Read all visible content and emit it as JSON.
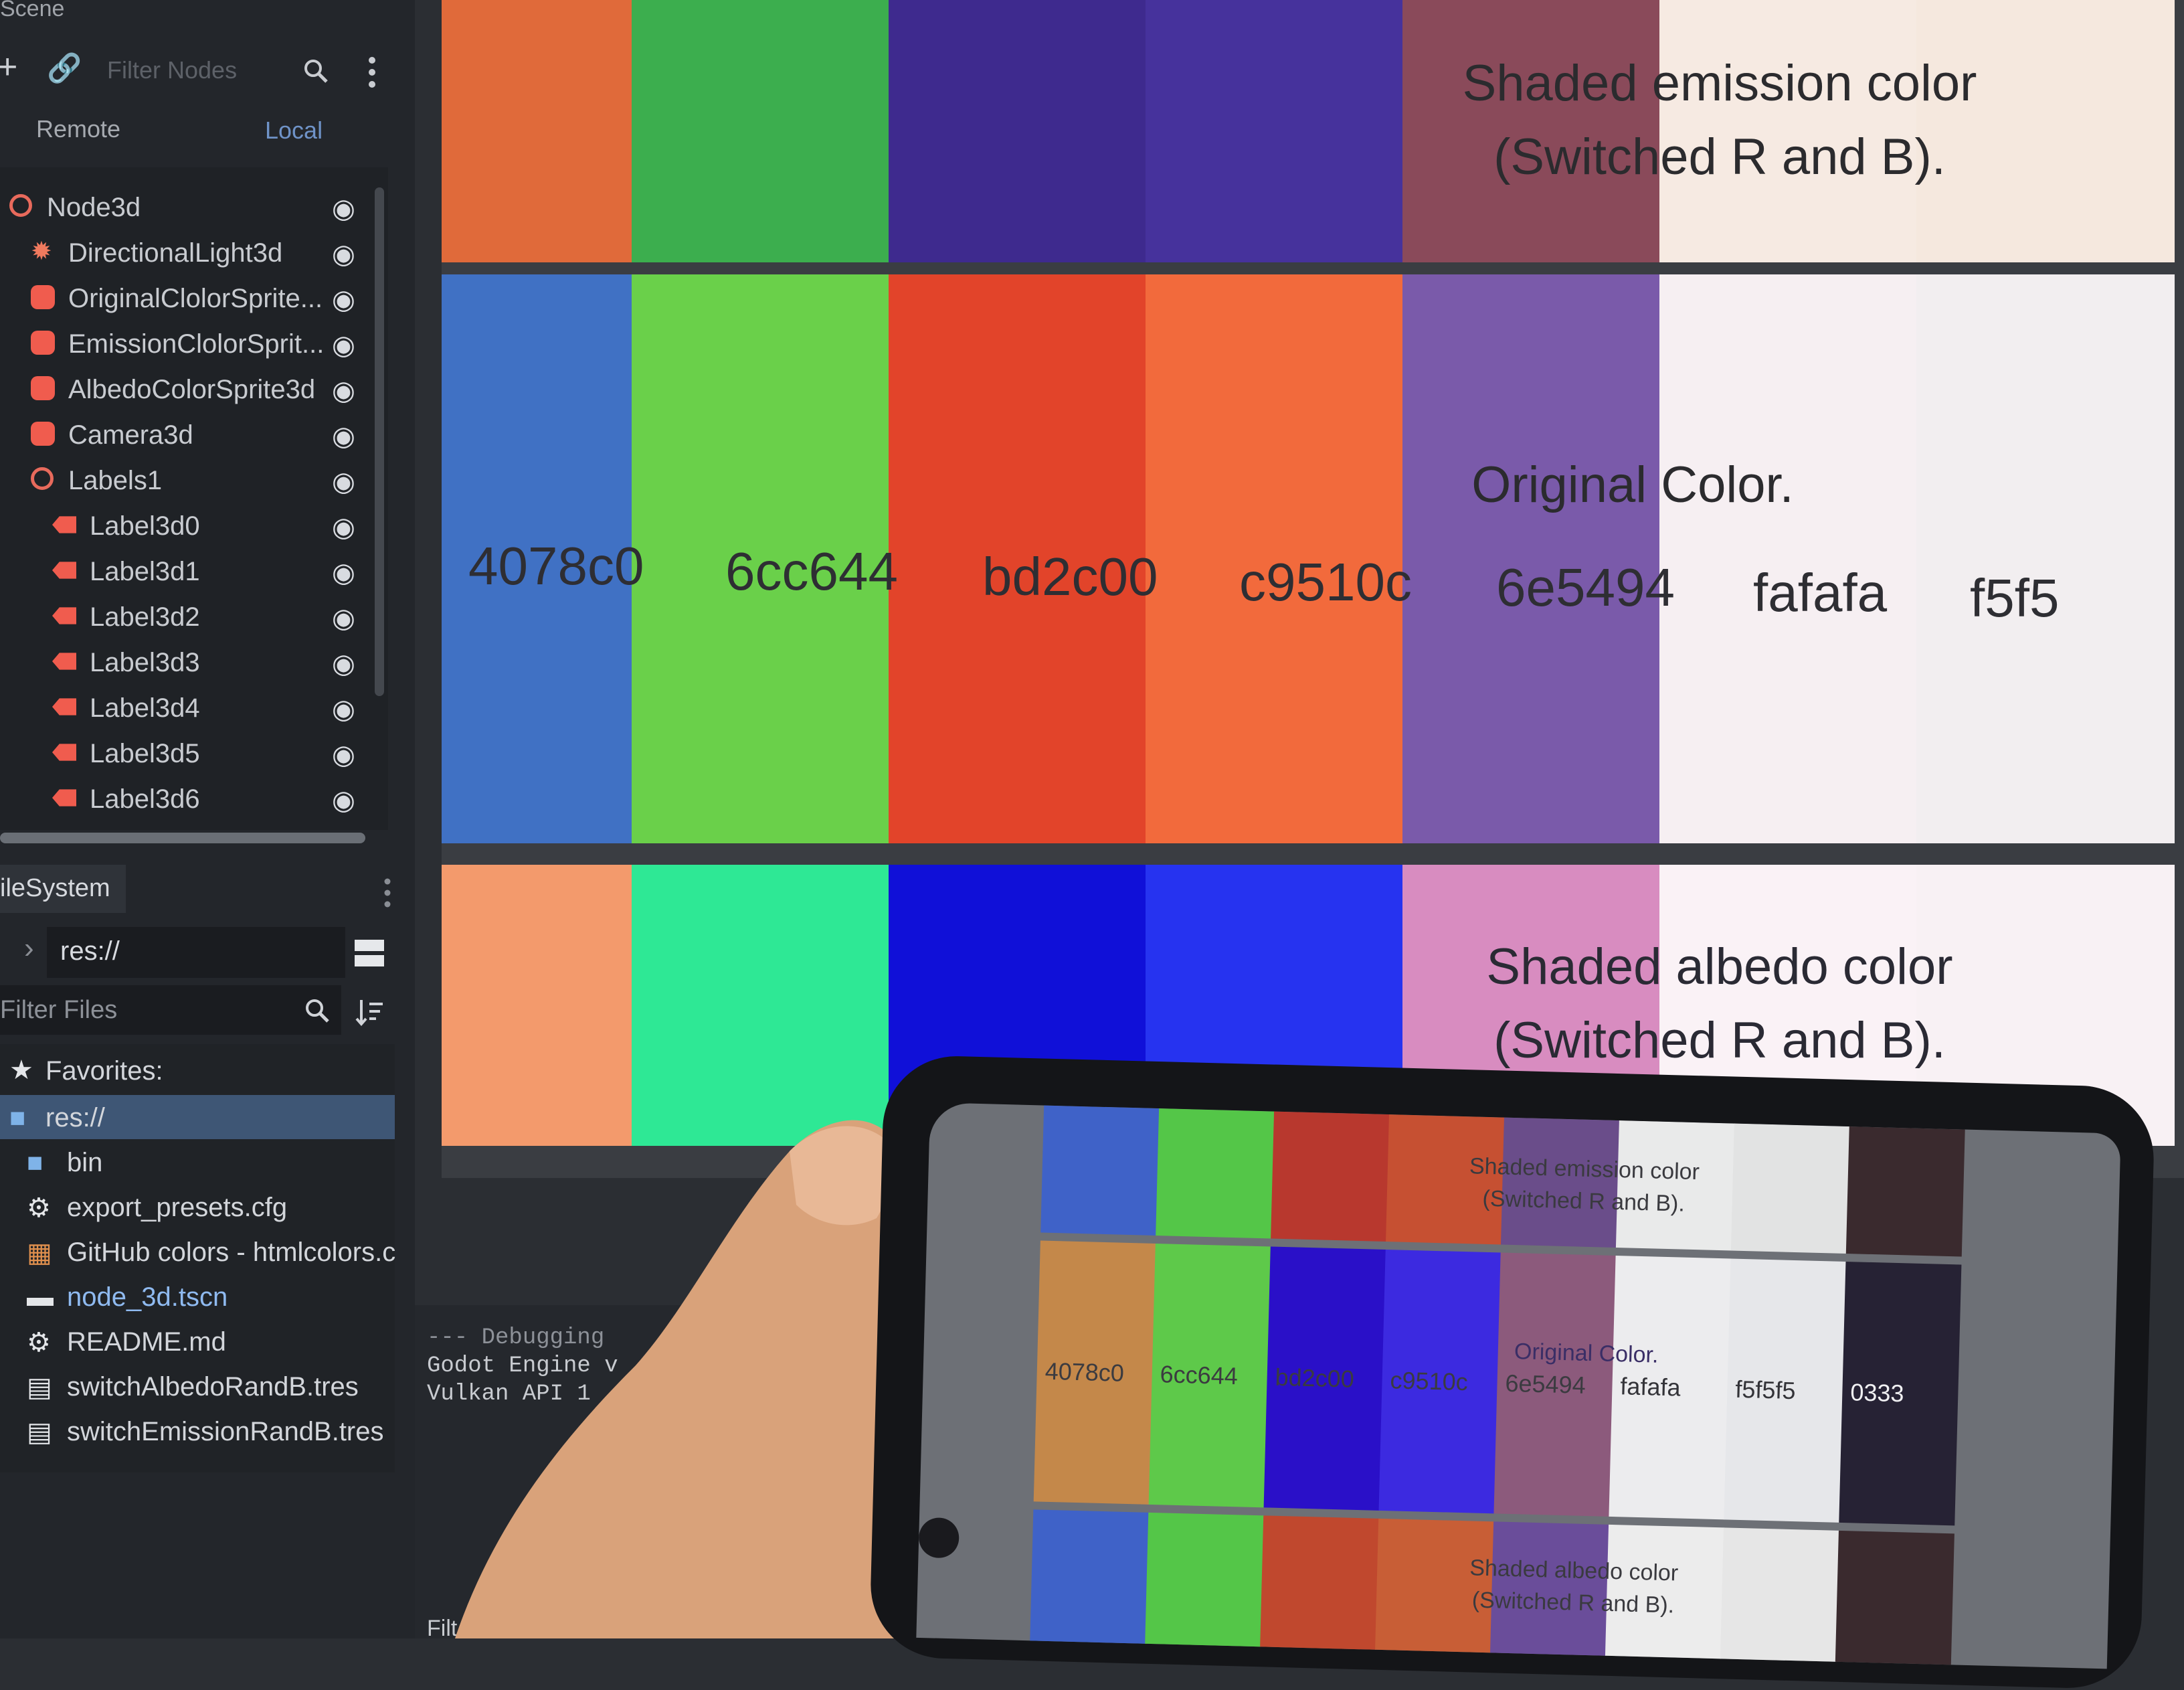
{
  "scene_panel": {
    "title": "Scene",
    "filter_placeholder": "Filter Nodes",
    "tabs": {
      "remote": "Remote",
      "local": "Local"
    },
    "nodes": [
      {
        "label": "Node3d",
        "icon": "node3d-icon",
        "indent": 0
      },
      {
        "label": "DirectionalLight3d",
        "icon": "light-icon",
        "indent": 1
      },
      {
        "label": "OriginalClolorSprite...",
        "icon": "sprite-icon",
        "indent": 1
      },
      {
        "label": "EmissionClolorSprit...",
        "icon": "sprite-icon",
        "indent": 1
      },
      {
        "label": "AlbedoColorSprite3d",
        "icon": "sprite-icon",
        "indent": 1
      },
      {
        "label": "Camera3d",
        "icon": "camera-icon",
        "indent": 1
      },
      {
        "label": "Labels1",
        "icon": "node3d-icon",
        "indent": 1
      },
      {
        "label": "Label3d0",
        "icon": "label-icon",
        "indent": 2
      },
      {
        "label": "Label3d1",
        "icon": "label-icon",
        "indent": 2
      },
      {
        "label": "Label3d2",
        "icon": "label-icon",
        "indent": 2
      },
      {
        "label": "Label3d3",
        "icon": "label-icon",
        "indent": 2
      },
      {
        "label": "Label3d4",
        "icon": "label-icon",
        "indent": 2
      },
      {
        "label": "Label3d5",
        "icon": "label-icon",
        "indent": 2
      },
      {
        "label": "Label3d6",
        "icon": "label-icon",
        "indent": 2
      }
    ]
  },
  "filesystem": {
    "tab": "ileSystem",
    "path": "res://",
    "filter_placeholder": "Filter Files",
    "favorites": "Favorites:",
    "items": [
      {
        "label": "res://",
        "icon": "folder-icon",
        "selected": true
      },
      {
        "label": "bin",
        "icon": "folder-icon"
      },
      {
        "label": "export_presets.cfg",
        "icon": "gear-icon"
      },
      {
        "label": "GitHub colors - htmlcolors.c",
        "icon": "image-icon"
      },
      {
        "label": "node_3d.tscn",
        "icon": "scene-icon"
      },
      {
        "label": "README.md",
        "icon": "gear-icon"
      },
      {
        "label": "switchAlbedoRandB.tres",
        "icon": "resource-icon"
      },
      {
        "label": "switchEmissionRandB.tres",
        "icon": "resource-icon"
      }
    ]
  },
  "debugger": {
    "lines": [
      "--- Debugging",
      "Godot Engine v",
      "Vulkan API 1"
    ],
    "filter": "Filt"
  },
  "viewport": {
    "emission_caption": "Shaded emission color\n(Switched R and B).",
    "original_caption": "Original Color.",
    "albedo_caption": "Shaded albedo color\n(Switched R and B).",
    "hex_labels": [
      "4078c0",
      "6cc644",
      "bd2c00",
      "c9510c",
      "6e5494",
      "fafafa",
      "f5f5"
    ],
    "emission_colors": [
      "#e06a3a",
      "#3cae4e",
      "#3e2a8e",
      "#46329c",
      "#8a4a5a",
      "#f6eae2",
      "#f5e8de"
    ],
    "original_colors": [
      "#4071c4",
      "#6ad04a",
      "#e2442a",
      "#f26a3c",
      "#7a5aaa",
      "#f6eff2",
      "#f2eef0"
    ],
    "albedo_colors": [
      "#f39a6c",
      "#2ee895",
      "#1010d8",
      "#2633f0",
      "#d88cc0",
      "#faf2f6",
      "#f8f1f4"
    ]
  },
  "phone": {
    "emission_caption": "Shaded emission color\n(Switched R and B).",
    "original_caption": "Original Color.",
    "albedo_caption": "Shaded albedo color\n(Switched R and B).",
    "hex_labels": [
      "4078c0",
      "6cc644",
      "bd2c00",
      "c9510c",
      "6e5494",
      "fafafa",
      "f5f5f5",
      "0333"
    ],
    "emission_colors": [
      "#3f62c8",
      "#54c648",
      "#b8382e",
      "#c65032",
      "#6a4d8a",
      "#e9eaea",
      "#e2e3e3",
      "#3a2a2e"
    ],
    "original_colors": [
      "#c4884a",
      "#5ec94a",
      "#2a10c8",
      "#3c2ae0",
      "#8c5a7c",
      "#ececee",
      "#e6e7ea",
      "#262234"
    ],
    "albedo_colors": [
      "#3f62c8",
      "#54c648",
      "#c0482e",
      "#c85e36",
      "#6a4d9a",
      "#ececec",
      "#e6e6e6",
      "#3a2a2e"
    ]
  }
}
